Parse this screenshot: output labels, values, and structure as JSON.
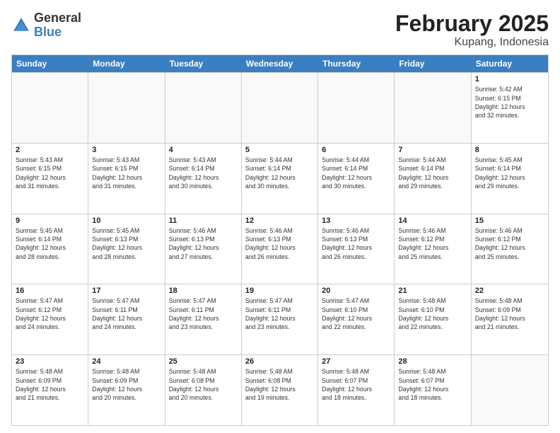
{
  "logo": {
    "general": "General",
    "blue": "Blue"
  },
  "title": "February 2025",
  "subtitle": "Kupang, Indonesia",
  "weekdays": [
    "Sunday",
    "Monday",
    "Tuesday",
    "Wednesday",
    "Thursday",
    "Friday",
    "Saturday"
  ],
  "weeks": [
    [
      {
        "day": "",
        "info": ""
      },
      {
        "day": "",
        "info": ""
      },
      {
        "day": "",
        "info": ""
      },
      {
        "day": "",
        "info": ""
      },
      {
        "day": "",
        "info": ""
      },
      {
        "day": "",
        "info": ""
      },
      {
        "day": "1",
        "info": "Sunrise: 5:42 AM\nSunset: 6:15 PM\nDaylight: 12 hours\nand 32 minutes."
      }
    ],
    [
      {
        "day": "2",
        "info": "Sunrise: 5:43 AM\nSunset: 6:15 PM\nDaylight: 12 hours\nand 31 minutes."
      },
      {
        "day": "3",
        "info": "Sunrise: 5:43 AM\nSunset: 6:15 PM\nDaylight: 12 hours\nand 31 minutes."
      },
      {
        "day": "4",
        "info": "Sunrise: 5:43 AM\nSunset: 6:14 PM\nDaylight: 12 hours\nand 30 minutes."
      },
      {
        "day": "5",
        "info": "Sunrise: 5:44 AM\nSunset: 6:14 PM\nDaylight: 12 hours\nand 30 minutes."
      },
      {
        "day": "6",
        "info": "Sunrise: 5:44 AM\nSunset: 6:14 PM\nDaylight: 12 hours\nand 30 minutes."
      },
      {
        "day": "7",
        "info": "Sunrise: 5:44 AM\nSunset: 6:14 PM\nDaylight: 12 hours\nand 29 minutes."
      },
      {
        "day": "8",
        "info": "Sunrise: 5:45 AM\nSunset: 6:14 PM\nDaylight: 12 hours\nand 29 minutes."
      }
    ],
    [
      {
        "day": "9",
        "info": "Sunrise: 5:45 AM\nSunset: 6:14 PM\nDaylight: 12 hours\nand 28 minutes."
      },
      {
        "day": "10",
        "info": "Sunrise: 5:45 AM\nSunset: 6:13 PM\nDaylight: 12 hours\nand 28 minutes."
      },
      {
        "day": "11",
        "info": "Sunrise: 5:46 AM\nSunset: 6:13 PM\nDaylight: 12 hours\nand 27 minutes."
      },
      {
        "day": "12",
        "info": "Sunrise: 5:46 AM\nSunset: 6:13 PM\nDaylight: 12 hours\nand 26 minutes."
      },
      {
        "day": "13",
        "info": "Sunrise: 5:46 AM\nSunset: 6:13 PM\nDaylight: 12 hours\nand 26 minutes."
      },
      {
        "day": "14",
        "info": "Sunrise: 5:46 AM\nSunset: 6:12 PM\nDaylight: 12 hours\nand 25 minutes."
      },
      {
        "day": "15",
        "info": "Sunrise: 5:46 AM\nSunset: 6:12 PM\nDaylight: 12 hours\nand 25 minutes."
      }
    ],
    [
      {
        "day": "16",
        "info": "Sunrise: 5:47 AM\nSunset: 6:12 PM\nDaylight: 12 hours\nand 24 minutes."
      },
      {
        "day": "17",
        "info": "Sunrise: 5:47 AM\nSunset: 6:11 PM\nDaylight: 12 hours\nand 24 minutes."
      },
      {
        "day": "18",
        "info": "Sunrise: 5:47 AM\nSunset: 6:11 PM\nDaylight: 12 hours\nand 23 minutes."
      },
      {
        "day": "19",
        "info": "Sunrise: 5:47 AM\nSunset: 6:11 PM\nDaylight: 12 hours\nand 23 minutes."
      },
      {
        "day": "20",
        "info": "Sunrise: 5:47 AM\nSunset: 6:10 PM\nDaylight: 12 hours\nand 22 minutes."
      },
      {
        "day": "21",
        "info": "Sunrise: 5:48 AM\nSunset: 6:10 PM\nDaylight: 12 hours\nand 22 minutes."
      },
      {
        "day": "22",
        "info": "Sunrise: 5:48 AM\nSunset: 6:09 PM\nDaylight: 12 hours\nand 21 minutes."
      }
    ],
    [
      {
        "day": "23",
        "info": "Sunrise: 5:48 AM\nSunset: 6:09 PM\nDaylight: 12 hours\nand 21 minutes."
      },
      {
        "day": "24",
        "info": "Sunrise: 5:48 AM\nSunset: 6:09 PM\nDaylight: 12 hours\nand 20 minutes."
      },
      {
        "day": "25",
        "info": "Sunrise: 5:48 AM\nSunset: 6:08 PM\nDaylight: 12 hours\nand 20 minutes."
      },
      {
        "day": "26",
        "info": "Sunrise: 5:48 AM\nSunset: 6:08 PM\nDaylight: 12 hours\nand 19 minutes."
      },
      {
        "day": "27",
        "info": "Sunrise: 5:48 AM\nSunset: 6:07 PM\nDaylight: 12 hours\nand 18 minutes."
      },
      {
        "day": "28",
        "info": "Sunrise: 5:48 AM\nSunset: 6:07 PM\nDaylight: 12 hours\nand 18 minutes."
      },
      {
        "day": "",
        "info": ""
      }
    ]
  ]
}
